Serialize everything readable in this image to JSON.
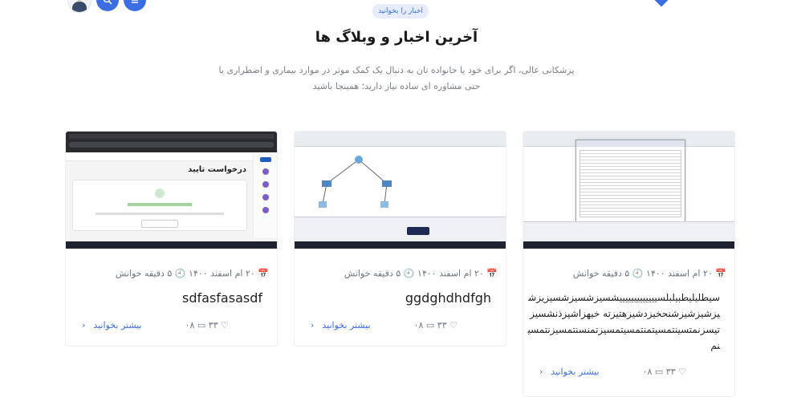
{
  "header": {
    "pill_label": "اخبار را بخوانید",
    "title": "آخرین اخبار و وبلاگ ها",
    "description": "پزشکانی عالی، اگر برای خود یا خانواده تان به دنبال یک کمک موثر در موارد بیماری و اضطراری یا حتی مشاوره ای ساده نیاز دارید؛ همینجا باشید"
  },
  "top_icons": [
    "avatar",
    "search-icon",
    "menu-icon"
  ],
  "accent": "#3b6de3",
  "cards": [
    {
      "date": "۲۰ ام اسفند ۱۴۰۰",
      "read_time": "۵ دقیقه خوانش",
      "title": "سیطلیلیطبیلبلسیییییییییییییشسیزشسیزشسیزیزشیزشیزشیزشنحخیزدشیزهتیزته خیهزاشیزذنشسیزتیسزنمتسینتمسیتمنتمسیتمسیزتمنسنتمسیزنتمسینم",
      "likes": "۳۳",
      "comments": "۰۸",
      "more_label": "بیشتر بخوانید"
    },
    {
      "date": "۲۰ ام اسفند ۱۴۰۰",
      "read_time": "۵ دقیقه خوانش",
      "title": "ggdghdhdfgh",
      "likes": "۳۳",
      "comments": "۰۸",
      "more_label": "بیشتر بخوانید"
    },
    {
      "date": "۲۰ ام اسفند ۱۴۰۰",
      "read_time": "۵ دقیقه خوانش",
      "title": "sdfasfasasdf",
      "likes": "۳۳",
      "comments": "۰۸",
      "more_label": "بیشتر بخوانید",
      "thumb_heading": "درخواست تایید"
    }
  ]
}
